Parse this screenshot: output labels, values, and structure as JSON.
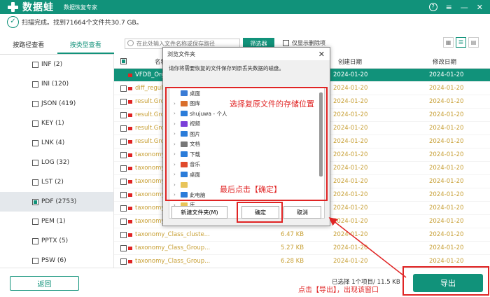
{
  "app": {
    "logo_text": "数据蛙",
    "subtitle": "数据恢复专家",
    "status": "扫描完成。找到71664个文件共30.7 GB。"
  },
  "tabs": [
    {
      "label": "按路径查看"
    },
    {
      "label": "按类型查看"
    }
  ],
  "sidebar": {
    "items": [
      {
        "label": "INF (2)"
      },
      {
        "label": "INI (120)"
      },
      {
        "label": "JSON (419)"
      },
      {
        "label": "KEY (1)"
      },
      {
        "label": "LNK (4)"
      },
      {
        "label": "LOG (32)"
      },
      {
        "label": "LST (2)"
      },
      {
        "label": "PDF (2753)"
      },
      {
        "label": "PEM (1)"
      },
      {
        "label": "PPTX (5)"
      },
      {
        "label": "PSW (6)"
      }
    ]
  },
  "toolbar": {
    "search_placeholder": "在此处输入文件名称或保存路径",
    "filter_label": "筛选器",
    "only_deleted_label": "仅显示删除项"
  },
  "table": {
    "headers": [
      "名称",
      "创建日期",
      "修改日期"
    ],
    "rows": [
      {
        "name": "VFDB_Orga",
        "size": "",
        "created": "2024-01-20",
        "modified": "2024-01-20"
      },
      {
        "name": "diff_regula",
        "size": "",
        "created": "2024-01-20",
        "modified": "2024-01-20"
      },
      {
        "name": "result.Gro",
        "size": "",
        "created": "2024-01-20",
        "modified": "2024-01-20"
      },
      {
        "name": "result.Gro",
        "size": "",
        "created": "2024-01-20",
        "modified": "2024-01-20"
      },
      {
        "name": "result.Gro",
        "size": "",
        "created": "2024-01-20",
        "modified": "2024-01-20"
      },
      {
        "name": "result.Gro",
        "size": "",
        "created": "2024-01-20",
        "modified": "2024-01-20"
      },
      {
        "name": "taxonomy_",
        "size": "",
        "created": "2024-01-20",
        "modified": "2024-01-20"
      },
      {
        "name": "taxonomy_",
        "size": "",
        "created": "2024-01-20",
        "modified": "2024-01-20"
      },
      {
        "name": "taxonomy_",
        "size": "",
        "created": "2024-01-20",
        "modified": "2024-01-20"
      },
      {
        "name": "taxonomy_",
        "size": "",
        "created": "2024-01-20",
        "modified": "2024-01-20"
      },
      {
        "name": "taxonomy_",
        "size": "",
        "created": "2024-01-20",
        "modified": "2024-01-20"
      },
      {
        "name": "taxonomy_Class_Group...",
        "size": "",
        "created": "2024-01-20",
        "modified": "2024-01-20"
      },
      {
        "name": "taxonomy_Class_cluste...",
        "size": "6.47 KB",
        "created": "2024-01-20",
        "modified": "2024-01-20"
      },
      {
        "name": "taxonomy_Class_Group...",
        "size": "5.27 KB",
        "created": "2024-01-20",
        "modified": "2024-01-20"
      },
      {
        "name": "taxonomy_Class_Group...",
        "size": "6.28 KB",
        "created": "2024-01-20",
        "modified": "2024-01-20"
      }
    ]
  },
  "dialog": {
    "title": "浏览文件夹",
    "description": "请你将需要恢复的文件保存到原丢失数据的磁盘。",
    "tree": [
      {
        "label": "桌面",
        "level": 0,
        "color": "#3a7bd5"
      },
      {
        "label": "图库",
        "level": 1,
        "color": "#d96f2b"
      },
      {
        "label": "shujuwa - 个人",
        "level": 1,
        "color": "#2b7cd9"
      },
      {
        "label": "视频",
        "level": 1,
        "color": "#7b3fd9"
      },
      {
        "label": "图片",
        "level": 1,
        "color": "#2b7cd9"
      },
      {
        "label": "文档",
        "level": 1,
        "color": "#777777"
      },
      {
        "label": "下载",
        "level": 1,
        "color": "#2b7cd9"
      },
      {
        "label": "音乐",
        "level": 1,
        "color": "#e04a2b"
      },
      {
        "label": "桌面",
        "level": 1,
        "color": "#2b7cd9"
      },
      {
        "label": "",
        "level": 1,
        "color": "#e8c45a"
      },
      {
        "label": "此电脑",
        "level": 1,
        "color": "#2b7cd9"
      },
      {
        "label": "库",
        "level": 1,
        "color": "#e8c45a"
      }
    ],
    "new_folder_label": "新建文件夹(M)",
    "ok_label": "确定",
    "cancel_label": "取消"
  },
  "annotations": {
    "choose_location": "选择复原文件的存储位置",
    "final_click": "最后点击【确定】",
    "export_note": "点击【导出】，出现该窗口"
  },
  "footer": {
    "back_label": "返回",
    "selection": "已选择 1个项目/ 11.5 KB",
    "export_label": "导出"
  },
  "colors": {
    "brand": "#11927a",
    "annotation": "#e02424"
  }
}
